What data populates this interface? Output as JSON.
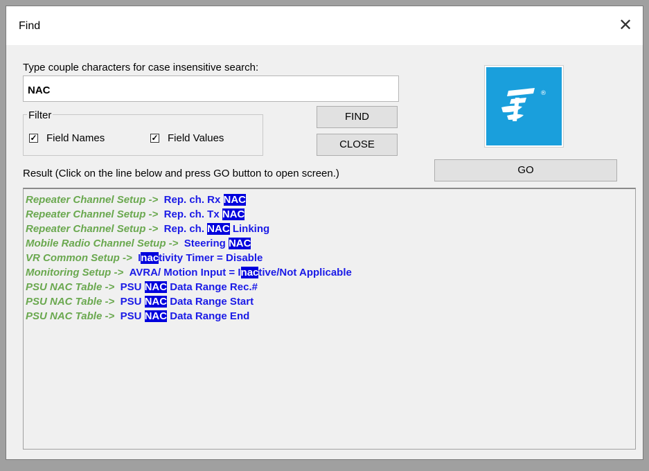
{
  "window": {
    "title": "Find",
    "close_glyph": "✕"
  },
  "search": {
    "prompt": "Type couple characters for case insensitive search:",
    "value": "NAC"
  },
  "filter": {
    "legend": "Filter",
    "field_names_label": "Field Names",
    "field_names_checked": true,
    "field_values_label": "Field Values",
    "field_values_checked": true
  },
  "buttons": {
    "find": "FIND",
    "close": "CLOSE",
    "go": "GO"
  },
  "logo": {
    "icon": "company-logo-icon",
    "registered_mark": "®",
    "bg_color": "#1a9fdc"
  },
  "result": {
    "label": "Result (Click on the line below and press GO button to open screen.)",
    "rows": [
      {
        "section": "Repeater Channel Setup ->",
        "before": "Rep. ch. Rx ",
        "match": "NAC",
        "after": ""
      },
      {
        "section": "Repeater Channel Setup ->",
        "before": "Rep. ch. Tx ",
        "match": "NAC",
        "after": ""
      },
      {
        "section": "Repeater Channel Setup ->",
        "before": "Rep. ch. ",
        "match": "NAC",
        "after": " Linking"
      },
      {
        "section": "Mobile Radio Channel Setup ->",
        "before": "Steering ",
        "match": "NAC",
        "after": ""
      },
      {
        "section": "VR Common Setup ->",
        "before": "I",
        "match": "nac",
        "after": "tivity Timer = Disable"
      },
      {
        "section": "Monitoring Setup ->",
        "before": "AVRA/ Motion Input = I",
        "match": "nac",
        "after": "tive/Not Applicable"
      },
      {
        "section": "PSU NAC Table ->",
        "before": "PSU ",
        "match": "NAC",
        "after": " Data Range Rec.#"
      },
      {
        "section": "PSU NAC Table ->",
        "before": "PSU ",
        "match": "NAC",
        "after": " Data Range Start"
      },
      {
        "section": "PSU NAC Table ->",
        "before": "PSU ",
        "match": "NAC",
        "after": " Data Range End"
      }
    ]
  },
  "colors": {
    "section_text": "#6aa84f",
    "field_text": "#1a1ae6",
    "highlight_bg": "#0000dd",
    "highlight_text": "#ffffff"
  }
}
